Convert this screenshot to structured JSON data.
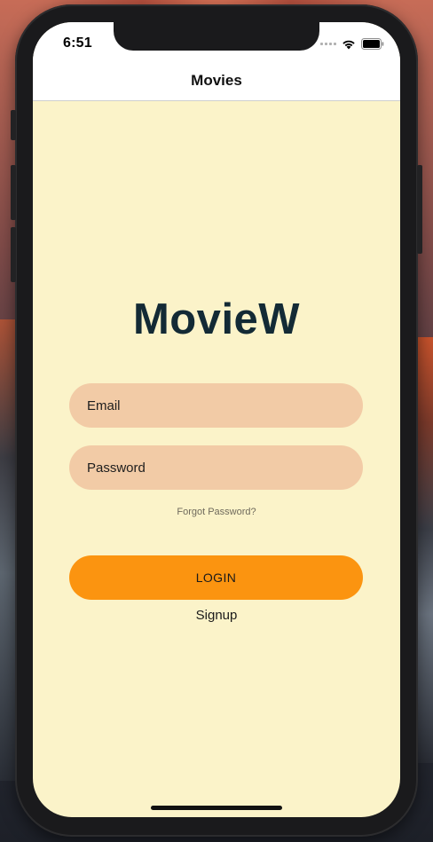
{
  "status_bar": {
    "time": "6:51"
  },
  "nav": {
    "title": "Movies"
  },
  "login": {
    "logo": "MovieW",
    "email_placeholder": "Email",
    "password_placeholder": "Password",
    "forgot_label": "Forgot Password?",
    "login_label": "LOGIN",
    "signup_label": "Signup"
  },
  "colors": {
    "background": "#fbf3c9",
    "field": "#f2cba6",
    "login_button": "#fb9410",
    "logo_text": "#132a35"
  },
  "icons": [
    "signal-icon",
    "wifi-icon",
    "battery-icon"
  ]
}
